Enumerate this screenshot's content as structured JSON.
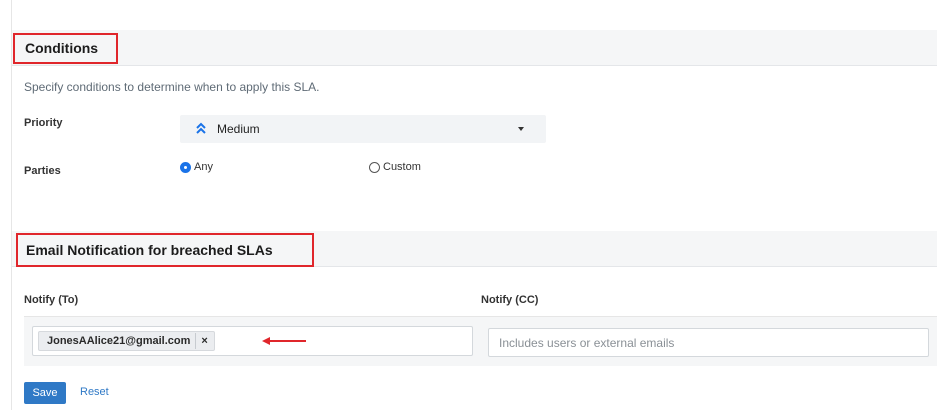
{
  "conditions": {
    "title": "Conditions",
    "description": "Specify conditions to determine when to apply this SLA.",
    "priority": {
      "label": "Priority",
      "value": "Medium",
      "icon": "double-chevron-up-icon",
      "icon_color": "#1a73e8"
    },
    "parties": {
      "label": "Parties",
      "options": [
        {
          "label": "Any",
          "selected": true
        },
        {
          "label": "Custom",
          "selected": false
        }
      ]
    }
  },
  "email_notification": {
    "title": "Email Notification for breached SLAs",
    "notify_to": {
      "label": "Notify (To)",
      "chips": [
        "JonesAAlice21@gmail.com"
      ],
      "remove_symbol": "×"
    },
    "notify_cc": {
      "label": "Notify (CC)",
      "value": "",
      "placeholder": "Includes users or external emails"
    }
  },
  "actions": {
    "save_label": "Save",
    "reset_label": "Reset"
  },
  "colors": {
    "accent": "#2f79c6",
    "highlight_box": "#e0262b",
    "arrow": "#e0262b"
  }
}
